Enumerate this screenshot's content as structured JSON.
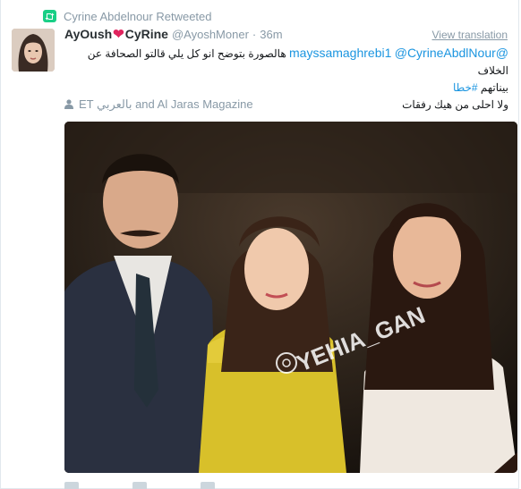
{
  "retweet": {
    "label": "Cyrine Abdelnour Retweeted",
    "icon": "retweet-icon"
  },
  "author": {
    "name_left": "AyOush",
    "name_right": "CyRine",
    "heart_icon": "heart-icon",
    "handle": "@AyoshMoner",
    "separator": "·",
    "time": "36m"
  },
  "view_translation": "View translation",
  "tweet": {
    "mention1": "@mayssamaghrebi1",
    "mention2": "@CyrineAbdlNour",
    "text_line1": "هالصورة بتوضح انو كل يلي قالتو الصحافة عن الخلاف",
    "text_line2_pre": "بيناتهم ",
    "hashtag": "#خطا",
    "text_line3": "ولا احلى من هيك رفقات"
  },
  "tagged": {
    "icon": "person-icon",
    "text": "ET بالعربي and Al Jaras Magazine"
  },
  "photo": {
    "watermark": "YEHIA_GAN",
    "watermark_icon": "instagram-icon"
  },
  "colors": {
    "link": "#1b95e0",
    "muted": "#8899a6",
    "retweet_green": "#19cf86",
    "heart": "#e0245e"
  }
}
